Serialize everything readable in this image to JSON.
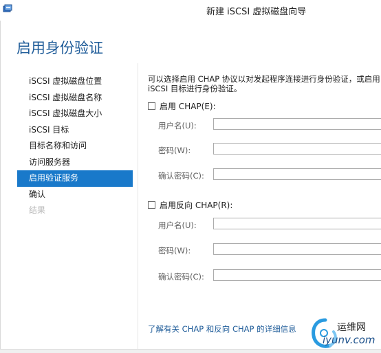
{
  "window": {
    "title": "新建 iSCSI 虚拟磁盘向导"
  },
  "page": {
    "heading": "启用身份验证"
  },
  "nav": {
    "items": [
      {
        "label": "iSCSI 虚拟磁盘位置"
      },
      {
        "label": "iSCSI 虚拟磁盘名称"
      },
      {
        "label": "iSCSI 虚拟磁盘大小"
      },
      {
        "label": "iSCSI 目标"
      },
      {
        "label": "目标名称和访问"
      },
      {
        "label": "访问服务器"
      },
      {
        "label": "启用验证服务"
      },
      {
        "label": "确认"
      },
      {
        "label": "结果"
      }
    ],
    "active_index": 6
  },
  "main": {
    "intro_line1": "可以选择启用 CHAP 协议以对发起程序连接进行身份验证，或启用",
    "intro_line2": "iSCSI 目标进行身份验证。",
    "chap": {
      "label": "启用 CHAP(E):",
      "checked": false,
      "username_label": "用户名(U):",
      "username_value": "",
      "password_label": "密码(W):",
      "password_value": "",
      "confirm_label": "确认密码(C):",
      "confirm_value": ""
    },
    "reverse_chap": {
      "label": "启用反向 CHAP(R):",
      "checked": false,
      "username_label": "用户名(U):",
      "username_value": "",
      "password_label": "密码(W):",
      "password_value": "",
      "confirm_label": "确认密码(C):",
      "confirm_value": ""
    },
    "info_link": "了解有关 CHAP 和反向 CHAP 的详细信息"
  },
  "watermark": {
    "cn": "运维网",
    "en": "iyunv.com"
  },
  "colors": {
    "accent": "#1979ca",
    "heading": "#1f5c99",
    "link": "#1f5c99",
    "disabled": "#b9b9b9"
  },
  "icons": {
    "app": "wizard-disk-icon",
    "watermark": "swirl-logo-icon"
  }
}
